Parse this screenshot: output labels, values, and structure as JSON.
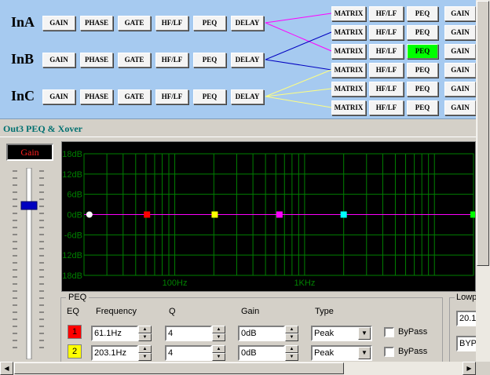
{
  "inputs": [
    {
      "label": "InA",
      "buttons": [
        "GAIN",
        "PHASE",
        "GATE",
        "HF/LF",
        "PEQ",
        "DELAY"
      ]
    },
    {
      "label": "InB",
      "buttons": [
        "GAIN",
        "PHASE",
        "GATE",
        "HF/LF",
        "PEQ",
        "DELAY"
      ]
    },
    {
      "label": "InC",
      "buttons": [
        "GAIN",
        "PHASE",
        "GATE",
        "HF/LF",
        "PEQ",
        "DELAY"
      ]
    }
  ],
  "outputs": [
    {
      "matrix": "MATRIX",
      "hflf": "HF/LF",
      "peq": "PEQ",
      "gain": "GAIN"
    },
    {
      "matrix": "MATRIX",
      "hflf": "HF/LF",
      "peq": "PEQ",
      "gain": "GAIN"
    },
    {
      "matrix": "MATRIX",
      "hflf": "HF/LF",
      "peq": "PEQ",
      "gain": "GAIN"
    },
    {
      "matrix": "MATRIX",
      "hflf": "HF/LF",
      "peq": "PEQ",
      "gain": "GAIN"
    },
    {
      "matrix": "MATRIX",
      "hflf": "HF/LF",
      "peq": "PEQ",
      "gain": "GAIN"
    },
    {
      "matrix": "MATRIX",
      "hflf": "HF/LF",
      "peq": "PEQ",
      "gain": "GAIN"
    }
  ],
  "active_output_peq": 3,
  "routing": [
    {
      "from": 0,
      "to": [
        0,
        2
      ],
      "color": "#ff00ff"
    },
    {
      "from": 1,
      "to": [
        1,
        3
      ],
      "color": "#0000c0"
    },
    {
      "from": 2,
      "to": [
        4,
        5
      ],
      "color": "#ffff80"
    },
    {
      "from": 2,
      "to": [
        3
      ],
      "color": "#ffff80"
    }
  ],
  "section_title": "Out3 PEQ & Xover",
  "gain_fader": {
    "label": "Gain"
  },
  "colors": {
    "routing_bg": "#a6caf0",
    "graph_bg": "#000000",
    "graph_grid": "#008000",
    "graph_curve": "#ff00ff",
    "active_button": "#00ff00",
    "section_title": "#007070",
    "gain_label": "#ff2020",
    "fader_thumb": "#0000c0"
  },
  "chart_data": {
    "type": "line",
    "xscale": "log",
    "xlim": [
      20,
      20000
    ],
    "ylim": [
      -18,
      18
    ],
    "ytick_labels": [
      "18dB",
      "12dB",
      "6dB",
      "0dB",
      "-6dB",
      "-12dB",
      "-18dB"
    ],
    "yticks": [
      18,
      12,
      6,
      0,
      -6,
      -12,
      -18
    ],
    "xtick_labels": [
      "100Hz",
      "1KHz"
    ],
    "xticks": [
      100,
      1000
    ],
    "grid": true,
    "series": [
      {
        "x": [
          20,
          20000
        ],
        "y": [
          0,
          0
        ],
        "color": "#ff00ff"
      }
    ],
    "handles": [
      {
        "freq": 22,
        "gain": 0,
        "color": "#ffffff"
      },
      {
        "freq": 61.1,
        "gain": 0,
        "color": "#ff0000"
      },
      {
        "freq": 203.1,
        "gain": 0,
        "color": "#ffff00"
      },
      {
        "freq": 640,
        "gain": 0,
        "color": "#ff00ff"
      },
      {
        "freq": 2000,
        "gain": 0,
        "color": "#00ffff"
      },
      {
        "freq": 20000,
        "gain": 0,
        "color": "#00ff00"
      }
    ]
  },
  "peq": {
    "legend": "PEQ",
    "headers": {
      "eq": "EQ",
      "frequency": "Frequency",
      "q": "Q",
      "gain": "Gain",
      "type": "Type"
    },
    "bands": [
      {
        "num": "1",
        "color": "#ff0000",
        "frequency": "61.1Hz",
        "q": "4",
        "gain": "0dB",
        "type": "Peak",
        "bypass_label": "ByPass"
      },
      {
        "num": "2",
        "color": "#ffff00",
        "frequency": "203.1Hz",
        "q": "4",
        "gain": "0dB",
        "type": "Peak",
        "bypass_label": "ByPass"
      }
    ]
  },
  "lowpass": {
    "legend": "Lowp",
    "value": "20.1",
    "type": "BYP"
  }
}
